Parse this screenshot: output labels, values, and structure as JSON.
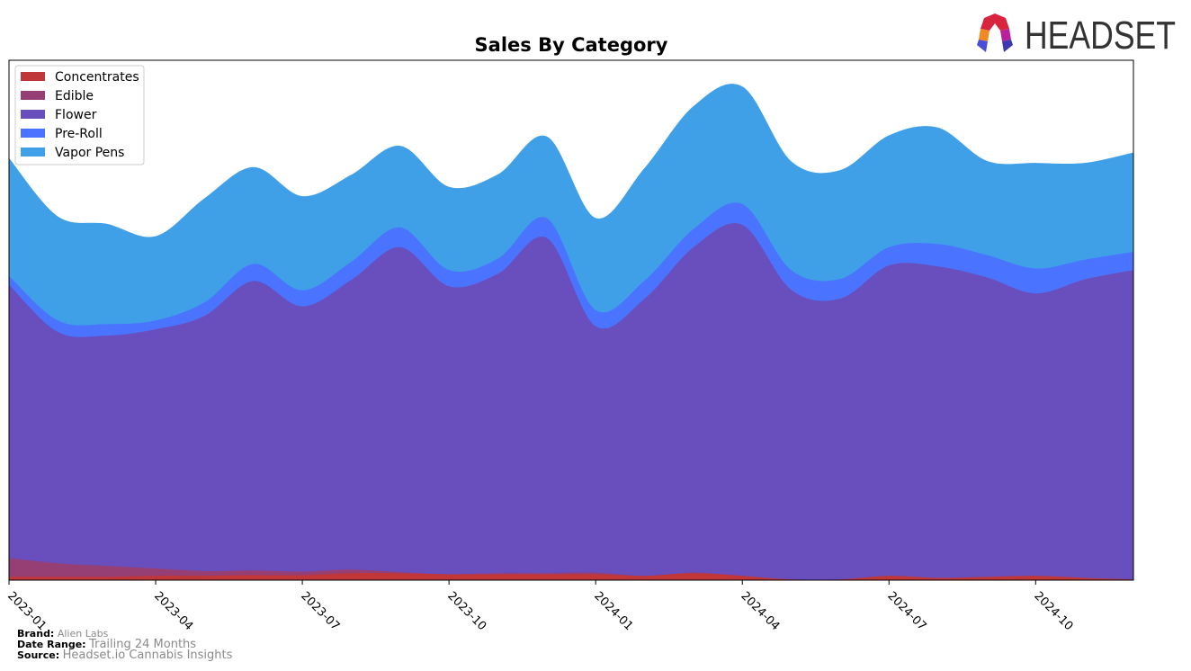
{
  "chart_data": {
    "type": "area",
    "stacked": true,
    "smooth": true,
    "title": "Sales By Category",
    "xlabel": "",
    "ylabel": "",
    "y_ticks_visible": false,
    "ylim": [
      0,
      100
    ],
    "y_units": "relative (top of plot = 100)",
    "x": [
      "2023-01",
      "2023-02",
      "2023-03",
      "2023-04",
      "2023-05",
      "2023-06",
      "2023-07",
      "2023-08",
      "2023-09",
      "2023-10",
      "2023-11",
      "2023-12",
      "2024-01",
      "2024-02",
      "2024-03",
      "2024-04",
      "2024-05",
      "2024-06",
      "2024-07",
      "2024-08",
      "2024-09",
      "2024-10",
      "2024-11",
      "2024-12"
    ],
    "x_ticks": [
      "2023-01",
      "2023-04",
      "2023-07",
      "2023-10",
      "2024-01",
      "2024-04",
      "2024-07",
      "2024-10"
    ],
    "legend": {
      "position": "top-left",
      "entries": [
        "Concentrates",
        "Edible",
        "Flower",
        "Pre-Roll",
        "Vapor Pens"
      ]
    },
    "series": [
      {
        "name": "Concentrates",
        "color": "#c0373a",
        "values": [
          0.7,
          0.7,
          0.7,
          0.9,
          0.9,
          1.0,
          1.0,
          1.4,
          1.4,
          1.2,
          1.2,
          1.2,
          1.2,
          0.9,
          1.4,
          0.9,
          0.2,
          0.2,
          0.9,
          0.5,
          0.7,
          0.9,
          0.5,
          0.2
        ]
      },
      {
        "name": "Edible",
        "color": "#963f74",
        "values": [
          3.6,
          2.6,
          2.1,
          1.4,
          0.9,
          0.9,
          0.7,
          0.7,
          0.2,
          0.0,
          0.2,
          0.2,
          0.3,
          0.0,
          0.1,
          0.0,
          0.0,
          0.0,
          0.0,
          0.0,
          0.0,
          0.0,
          0.0,
          0.0
        ]
      },
      {
        "name": "Flower",
        "color": "#684fbd",
        "values": [
          52.6,
          44.5,
          44.3,
          46.0,
          49.1,
          55.7,
          51.0,
          55.7,
          62.5,
          55.4,
          57.6,
          64.5,
          47.4,
          53.3,
          62.6,
          67.5,
          55.7,
          54.0,
          59.7,
          59.9,
          57.6,
          54.3,
          57.4,
          59.5
        ]
      },
      {
        "name": "Pre-Roll",
        "color": "#4a74ff",
        "values": [
          1.7,
          2.2,
          2.2,
          1.7,
          2.6,
          3.3,
          3.1,
          3.5,
          3.8,
          3.1,
          2.9,
          3.8,
          3.1,
          3.5,
          3.5,
          4.0,
          3.8,
          3.8,
          3.5,
          4.3,
          4.3,
          4.8,
          3.8,
          3.5
        ]
      },
      {
        "name": "Vapor Pens",
        "color": "#3fa0e8",
        "values": [
          22.5,
          19.9,
          19.2,
          16.1,
          19.9,
          18.5,
          18.0,
          16.6,
          15.6,
          15.9,
          16.1,
          15.6,
          17.6,
          21.5,
          23.5,
          22.5,
          20.8,
          20.8,
          21.4,
          22.3,
          18.0,
          20.2,
          18.5,
          19.0
        ]
      }
    ]
  },
  "logo": {
    "text": "HEADSET"
  },
  "footer": {
    "brand_label": "Brand:",
    "brand_value": "Alien Labs",
    "date_range_label": "Date Range:",
    "date_range_value": "Trailing 24 Months",
    "source_label": "Source:",
    "source_value": "Headset.io Cannabis Insights"
  }
}
